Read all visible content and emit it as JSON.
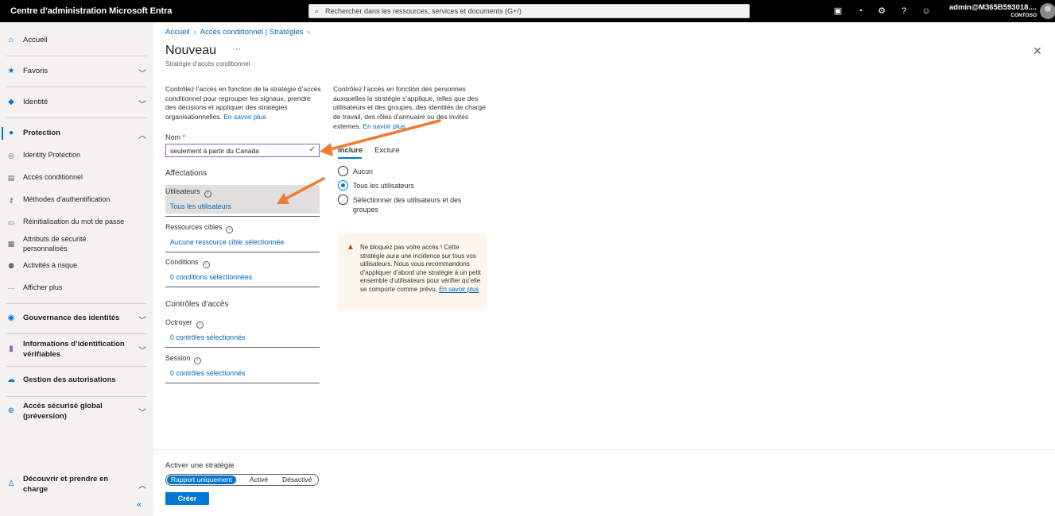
{
  "topbar": {
    "title": "Centre d’administration Microsoft Entra",
    "search_placeholder": "Rechercher dans les ressources, services et documents (G+/)",
    "account_user": "admin@M365B593018....",
    "account_tenant": "CONTOSO"
  },
  "sidebar": {
    "items": [
      {
        "label": "Accueil",
        "icon": "home-icon"
      },
      {
        "label": "Favoris",
        "icon": "star-icon"
      },
      {
        "label": "Identité",
        "icon": "identity-icon"
      },
      {
        "label": "Protection",
        "icon": "protection-icon"
      },
      {
        "label": "Identity Protection",
        "icon": "identity-protection-icon"
      },
      {
        "label": "Accès conditionnel",
        "icon": "conditional-access-icon"
      },
      {
        "label": "Méthodes d'authentification",
        "icon": "key-icon"
      },
      {
        "label": "Réinitialisation du mot de passe",
        "icon": "password-reset-icon"
      },
      {
        "label": "Attributs de sécurité personnalisés",
        "icon": "attributes-icon"
      },
      {
        "label": "Activités à risque",
        "icon": "risk-icon"
      },
      {
        "label": "Afficher plus",
        "icon": "more-icon"
      },
      {
        "label": "Gouvernance des identités",
        "icon": "governance-icon"
      },
      {
        "label": "Informations d’identification vérifiables",
        "icon": "verifiable-credentials-icon"
      },
      {
        "label": "Gestion des autorisations",
        "icon": "cloud-icon"
      },
      {
        "label": "Accès sécurisé global (préversion)",
        "icon": "globe-icon"
      },
      {
        "label": "Découvrir et prendre en charge",
        "icon": "person-icon"
      }
    ],
    "collapse": "«"
  },
  "breadcrumb": {
    "home": "Accueil",
    "section": "Accès conditionnel | Stratégies"
  },
  "page": {
    "title": "Nouveau",
    "subtitle": "Stratégie d’accès conditionnel"
  },
  "left": {
    "description": "Contrôlez l’accès en fonction de la stratégie d’accès conditionnel pour regrouper les signaux, prendre des décisions et appliquer des stratégies organisationnelles.",
    "learn_more": "En savoir plus",
    "name_label": "Nom",
    "name_required": "*",
    "name_value": "seulement à partir du Canada",
    "assignments_title": "Affectations",
    "users_label": "Utilisateurs",
    "users_value": "Tous les utilisateurs",
    "resources_label": "Ressources cibles",
    "resources_value": "Aucune ressource cible sélectionnée",
    "conditions_label": "Conditions",
    "conditions_value": "0 conditions sélectionnées",
    "access_controls_title": "Contrôles d’accès",
    "grant_label": "Octroyer",
    "grant_value": "0 contrôles sélectionnés",
    "session_label": "Session",
    "session_value": "0 contrôles sélectionnés"
  },
  "right": {
    "description": "Contrôlez l’accès en fonction des personnes auxquelles la stratégie s’applique, telles que des utilisateurs et des groupes, des identités de charge de travail, des rôles d’annuaire ou des invités externes.",
    "learn_more": "En savoir plus",
    "tab_include": "Inclure",
    "tab_exclude": "Exclure",
    "radio_none": "Aucun",
    "radio_all": "Tous les utilisateurs",
    "radio_select": "Sélectionner des utilisateurs et des groupes",
    "selected_radio": "Tous les utilisateurs",
    "warning_text": "Ne bloquez pas votre accès ! Cette stratégie aura une incidence sur tous vos utilisateurs. Nous vous recommandons d’appliquer d’abord une stratégie à un petit ensemble d’utilisateurs pour vérifier qu’elle se comporte comme prévu.",
    "warning_link": "En savoir plus"
  },
  "footer": {
    "enable_label": "Activer une stratégie",
    "opt_report": "Rapport uniquement",
    "opt_on": "Activé",
    "opt_off": "Désactivé",
    "selected": "Rapport uniquement",
    "create": "Créer"
  },
  "colors": {
    "accent": "#0078d4",
    "link": "#0067b8",
    "annotation_arrow": "#ed7d31",
    "valid_check": "#107c10"
  }
}
